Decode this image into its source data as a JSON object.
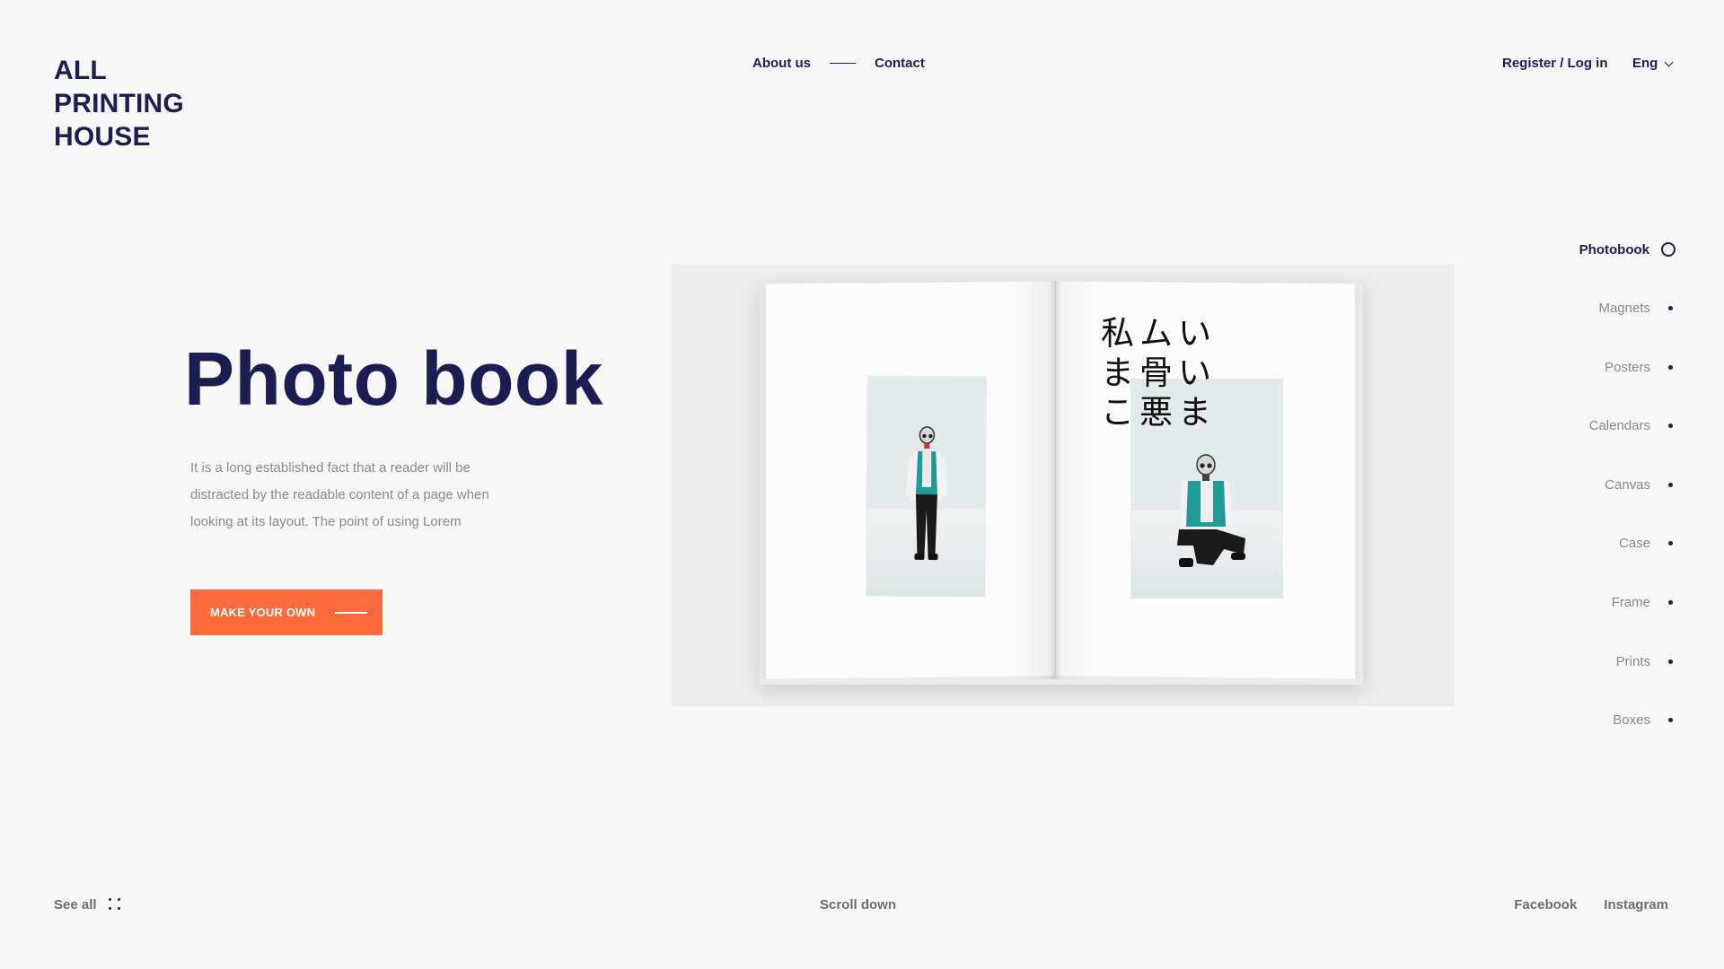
{
  "logo": {
    "lines": [
      "ALL",
      "PRINTING",
      "HOUSE"
    ]
  },
  "nav": {
    "about": "About us",
    "contact": "Contact"
  },
  "auth": {
    "label": "Register / Log in"
  },
  "language": {
    "current": "Eng"
  },
  "hero": {
    "title": "Photo book",
    "description": "It is a long established fact that a reader will be distracted by the readable content of a page when looking at its layout. The point of using Lorem",
    "cta_label": "MAKE YOUR OWN"
  },
  "book_image": {
    "kanji_rows": [
      "私ムい",
      "ま骨い",
      "こ悪ま"
    ]
  },
  "categories": [
    {
      "label": "Photobook",
      "active": true
    },
    {
      "label": "Magnets",
      "active": false
    },
    {
      "label": "Posters",
      "active": false
    },
    {
      "label": "Calendars",
      "active": false
    },
    {
      "label": "Canvas",
      "active": false
    },
    {
      "label": "Case",
      "active": false
    },
    {
      "label": "Frame",
      "active": false
    },
    {
      "label": "Prints",
      "active": false
    },
    {
      "label": "Boxes",
      "active": false
    }
  ],
  "footer": {
    "see_all": "See all",
    "scroll_down": "Scroll down",
    "facebook": "Facebook",
    "instagram": "Instagram"
  },
  "colors": {
    "brand_navy": "#1c1d52",
    "accent_orange": "#ff6b3d",
    "background": "#f8f8f8",
    "muted_text": "#8a8a8a"
  },
  "icons": {
    "language_dropdown": "chevron-down-icon",
    "active_category": "ring-icon",
    "category": "dot-icon",
    "see_all": "grid-dots-icon",
    "cta": "arrow-line-icon"
  }
}
